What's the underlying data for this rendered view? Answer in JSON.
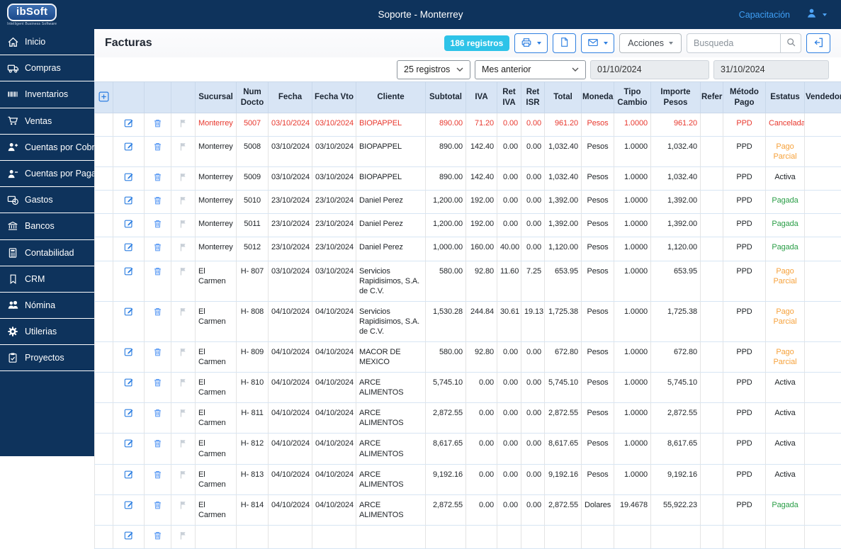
{
  "topbar": {
    "logo_title": "ibSoft",
    "logo_subtitle": "Intelligent Business Software",
    "title": "Soporte - Monterrey",
    "link_label": "Capacitación",
    "user_icons": [
      "person-icon",
      "chevron-down-icon"
    ]
  },
  "sidebar": {
    "items": [
      {
        "label": "Inicio",
        "icon": "home"
      },
      {
        "label": "Compras",
        "icon": "truck"
      },
      {
        "label": "Inventarios",
        "icon": "barcode"
      },
      {
        "label": "Ventas",
        "icon": "cart"
      },
      {
        "label": "Cuentas por Cobrar",
        "icon": "person-plus"
      },
      {
        "label": "Cuentas por Pagar",
        "icon": "person-minus"
      },
      {
        "label": "Gastos",
        "icon": "coins"
      },
      {
        "label": "Bancos",
        "icon": "bank"
      },
      {
        "label": "Contabilidad",
        "icon": "calculator"
      },
      {
        "label": "CRM",
        "icon": "bookmark"
      },
      {
        "label": "Nómina",
        "icon": "people"
      },
      {
        "label": "Utilerias",
        "icon": "gear"
      },
      {
        "label": "Proyectos",
        "icon": "clipboard"
      }
    ]
  },
  "header": {
    "page_title": "Facturas",
    "records_badge": "186 registros",
    "buttons": [
      {
        "icon": "printer-icon",
        "caret": true
      },
      {
        "icon": "file-icon",
        "caret": false
      },
      {
        "icon": "envelope-icon",
        "caret": true
      }
    ],
    "actions_label": "Acciones",
    "search_placeholder": "Busqueda",
    "exit_icon": "sign-out-icon"
  },
  "filters": {
    "page_size": "25 registros",
    "period": "Mes anterior",
    "date_from": "01/10/2024",
    "date_to": "31/10/2024"
  },
  "table": {
    "columns": [
      "",
      "",
      "",
      "",
      "Sucursal",
      "Num Docto",
      "Fecha",
      "Fecha Vto",
      "Cliente",
      "Subtotal",
      "IVA",
      "Ret IVA",
      "Ret ISR",
      "Total",
      "Moneda",
      "Tipo Cambio",
      "Importe Pesos",
      "Refer",
      "Método Pago",
      "Estatus",
      "Vendedor"
    ],
    "fields": [
      "sucursal",
      "num_docto",
      "fecha",
      "fecha_vto",
      "cliente",
      "subtotal",
      "iva",
      "ret_iva",
      "ret_isr",
      "total",
      "moneda",
      "tipo_cambio",
      "importe_pesos",
      "refer",
      "metodo_pago",
      "estatus",
      "vendedor"
    ],
    "rows": [
      {
        "cancelled": true,
        "sucursal": "Monterrey",
        "num_docto": "5007",
        "fecha": "03/10/2024",
        "fecha_vto": "03/10/2024",
        "cliente": "BIOPAPPEL",
        "subtotal": "890.00",
        "iva": "71.20",
        "ret_iva": "0.00",
        "ret_isr": "0.00",
        "total": "961.20",
        "moneda": "Pesos",
        "tipo_cambio": "1.0000",
        "importe_pesos": "961.20",
        "refer": "",
        "metodo_pago": "PPD",
        "estatus": "Cancelada",
        "vendedor": ""
      },
      {
        "sucursal": "Monterrey",
        "num_docto": "5008",
        "fecha": "03/10/2024",
        "fecha_vto": "03/10/2024",
        "cliente": "BIOPAPPEL",
        "subtotal": "890.00",
        "iva": "142.40",
        "ret_iva": "0.00",
        "ret_isr": "0.00",
        "total": "1,032.40",
        "moneda": "Pesos",
        "tipo_cambio": "1.0000",
        "importe_pesos": "1,032.40",
        "refer": "",
        "metodo_pago": "PPD",
        "estatus": "Pago Parcial",
        "vendedor": ""
      },
      {
        "sucursal": "Monterrey",
        "num_docto": "5009",
        "fecha": "03/10/2024",
        "fecha_vto": "03/10/2024",
        "cliente": "BIOPAPPEL",
        "subtotal": "890.00",
        "iva": "142.40",
        "ret_iva": "0.00",
        "ret_isr": "0.00",
        "total": "1,032.40",
        "moneda": "Pesos",
        "tipo_cambio": "1.0000",
        "importe_pesos": "1,032.40",
        "refer": "",
        "metodo_pago": "PPD",
        "estatus": "Activa",
        "vendedor": ""
      },
      {
        "sucursal": "Monterrey",
        "num_docto": "5010",
        "fecha": "23/10/2024",
        "fecha_vto": "23/10/2024",
        "cliente": "Daniel Perez",
        "subtotal": "1,200.00",
        "iva": "192.00",
        "ret_iva": "0.00",
        "ret_isr": "0.00",
        "total": "1,392.00",
        "moneda": "Pesos",
        "tipo_cambio": "1.0000",
        "importe_pesos": "1,392.00",
        "refer": "",
        "metodo_pago": "PPD",
        "estatus": "Pagada",
        "vendedor": ""
      },
      {
        "sucursal": "Monterrey",
        "num_docto": "5011",
        "fecha": "23/10/2024",
        "fecha_vto": "23/10/2024",
        "cliente": "Daniel Perez",
        "subtotal": "1,200.00",
        "iva": "192.00",
        "ret_iva": "0.00",
        "ret_isr": "0.00",
        "total": "1,392.00",
        "moneda": "Pesos",
        "tipo_cambio": "1.0000",
        "importe_pesos": "1,392.00",
        "refer": "",
        "metodo_pago": "PPD",
        "estatus": "Pagada",
        "vendedor": ""
      },
      {
        "sucursal": "Monterrey",
        "num_docto": "5012",
        "fecha": "23/10/2024",
        "fecha_vto": "23/10/2024",
        "cliente": "Daniel Perez",
        "subtotal": "1,000.00",
        "iva": "160.00",
        "ret_iva": "40.00",
        "ret_isr": "0.00",
        "total": "1,120.00",
        "moneda": "Pesos",
        "tipo_cambio": "1.0000",
        "importe_pesos": "1,120.00",
        "refer": "",
        "metodo_pago": "PPD",
        "estatus": "Pagada",
        "vendedor": ""
      },
      {
        "sucursal": "El Carmen",
        "num_docto": "H- 807",
        "fecha": "03/10/2024",
        "fecha_vto": "03/10/2024",
        "cliente": "Servicios Rapidisimos, S.A. de C.V.",
        "subtotal": "580.00",
        "iva": "92.80",
        "ret_iva": "11.60",
        "ret_isr": "7.25",
        "total": "653.95",
        "moneda": "Pesos",
        "tipo_cambio": "1.0000",
        "importe_pesos": "653.95",
        "refer": "",
        "metodo_pago": "PPD",
        "estatus": "Pago Parcial",
        "vendedor": ""
      },
      {
        "sucursal": "El Carmen",
        "num_docto": "H- 808",
        "fecha": "04/10/2024",
        "fecha_vto": "04/10/2024",
        "cliente": "Servicios Rapidisimos, S.A. de C.V.",
        "subtotal": "1,530.28",
        "iva": "244.84",
        "ret_iva": "30.61",
        "ret_isr": "19.13",
        "total": "1,725.38",
        "moneda": "Pesos",
        "tipo_cambio": "1.0000",
        "importe_pesos": "1,725.38",
        "refer": "",
        "metodo_pago": "PPD",
        "estatus": "Pago Parcial",
        "vendedor": ""
      },
      {
        "sucursal": "El Carmen",
        "num_docto": "H- 809",
        "fecha": "04/10/2024",
        "fecha_vto": "04/10/2024",
        "cliente": "MACOR DE MEXICO",
        "subtotal": "580.00",
        "iva": "92.80",
        "ret_iva": "0.00",
        "ret_isr": "0.00",
        "total": "672.80",
        "moneda": "Pesos",
        "tipo_cambio": "1.0000",
        "importe_pesos": "672.80",
        "refer": "",
        "metodo_pago": "PPD",
        "estatus": "Pago Parcial",
        "vendedor": ""
      },
      {
        "sucursal": "El Carmen",
        "num_docto": "H- 810",
        "fecha": "04/10/2024",
        "fecha_vto": "04/10/2024",
        "cliente": "ARCE ALIMENTOS",
        "subtotal": "5,745.10",
        "iva": "0.00",
        "ret_iva": "0.00",
        "ret_isr": "0.00",
        "total": "5,745.10",
        "moneda": "Pesos",
        "tipo_cambio": "1.0000",
        "importe_pesos": "5,745.10",
        "refer": "",
        "metodo_pago": "PPD",
        "estatus": "Activa",
        "vendedor": ""
      },
      {
        "sucursal": "El Carmen",
        "num_docto": "H- 811",
        "fecha": "04/10/2024",
        "fecha_vto": "04/10/2024",
        "cliente": "ARCE ALIMENTOS",
        "subtotal": "2,872.55",
        "iva": "0.00",
        "ret_iva": "0.00",
        "ret_isr": "0.00",
        "total": "2,872.55",
        "moneda": "Pesos",
        "tipo_cambio": "1.0000",
        "importe_pesos": "2,872.55",
        "refer": "",
        "metodo_pago": "PPD",
        "estatus": "Activa",
        "vendedor": ""
      },
      {
        "sucursal": "El Carmen",
        "num_docto": "H- 812",
        "fecha": "04/10/2024",
        "fecha_vto": "04/10/2024",
        "cliente": "ARCE ALIMENTOS",
        "subtotal": "8,617.65",
        "iva": "0.00",
        "ret_iva": "0.00",
        "ret_isr": "0.00",
        "total": "8,617.65",
        "moneda": "Pesos",
        "tipo_cambio": "1.0000",
        "importe_pesos": "8,617.65",
        "refer": "",
        "metodo_pago": "PPD",
        "estatus": "Activa",
        "vendedor": ""
      },
      {
        "sucursal": "El Carmen",
        "num_docto": "H- 813",
        "fecha": "04/10/2024",
        "fecha_vto": "04/10/2024",
        "cliente": "ARCE ALIMENTOS",
        "subtotal": "9,192.16",
        "iva": "0.00",
        "ret_iva": "0.00",
        "ret_isr": "0.00",
        "total": "9,192.16",
        "moneda": "Pesos",
        "tipo_cambio": "1.0000",
        "importe_pesos": "9,192.16",
        "refer": "",
        "metodo_pago": "PPD",
        "estatus": "Activa",
        "vendedor": ""
      },
      {
        "sucursal": "El Carmen",
        "num_docto": "H- 814",
        "fecha": "04/10/2024",
        "fecha_vto": "04/10/2024",
        "cliente": "ARCE ALIMENTOS",
        "subtotal": "2,872.55",
        "iva": "0.00",
        "ret_iva": "0.00",
        "ret_isr": "0.00",
        "total": "2,872.55",
        "moneda": "Dolares",
        "tipo_cambio": "19.4678",
        "importe_pesos": "55,922.23",
        "refer": "",
        "metodo_pago": "PPD",
        "estatus": "Pagada",
        "vendedor": ""
      },
      {
        "partial": true
      }
    ]
  },
  "colors": {
    "navy": "#0e335c",
    "accent_blue": "#2a7de1",
    "badge_cyan": "#2ec3e8",
    "link_blue": "#3f9ff5",
    "table_header_bg": "#d8e5f5",
    "cancelled_row": "#e8392f",
    "status": {
      "Cancelada": "#e8392f",
      "Pago Parcial": "#f6a23c",
      "Activa": "#212529",
      "Pagada": "#2a9e47"
    }
  }
}
